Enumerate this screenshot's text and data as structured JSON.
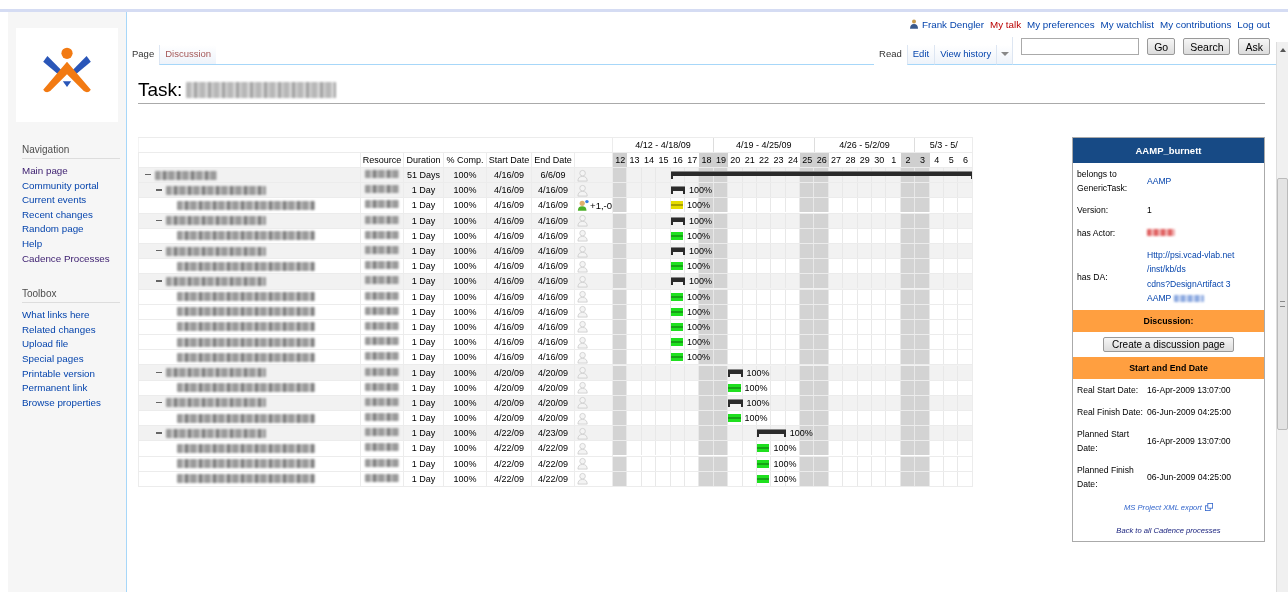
{
  "personal_links": [
    {
      "label": "Frank Dengler",
      "user": true,
      "missing": false
    },
    {
      "label": "My talk",
      "user": false,
      "missing": true
    },
    {
      "label": "My preferences",
      "user": false,
      "missing": false
    },
    {
      "label": "My watchlist",
      "user": false,
      "missing": false
    },
    {
      "label": "My contributions",
      "user": false,
      "missing": false
    },
    {
      "label": "Log out",
      "user": false,
      "missing": false
    }
  ],
  "left_tabs": [
    {
      "label": "Page",
      "selected": true,
      "missing": false
    },
    {
      "label": "Discussion",
      "selected": false,
      "missing": true
    }
  ],
  "right_tabs": [
    {
      "label": "Read",
      "selected": true
    },
    {
      "label": "Edit",
      "selected": false
    },
    {
      "label": "View history",
      "selected": false
    }
  ],
  "search": {
    "buttons": [
      "Go",
      "Search",
      "Ask"
    ]
  },
  "sidebar": {
    "sections": [
      {
        "heading": "Navigation",
        "items": [
          {
            "label": "Main page",
            "visited": true
          },
          {
            "label": "Community portal",
            "visited": false
          },
          {
            "label": "Current events",
            "visited": false
          },
          {
            "label": "Recent changes",
            "visited": false
          },
          {
            "label": "Random page",
            "visited": false
          },
          {
            "label": "Help",
            "visited": false
          },
          {
            "label": "Cadence Processes",
            "visited": true
          }
        ]
      },
      {
        "heading": "Toolbox",
        "items": [
          {
            "label": "What links here",
            "visited": false
          },
          {
            "label": "Related changes",
            "visited": false
          },
          {
            "label": "Upload file",
            "visited": false
          },
          {
            "label": "Special pages",
            "visited": false
          },
          {
            "label": "Printable version",
            "visited": false
          },
          {
            "label": "Permanent link",
            "visited": false
          },
          {
            "label": "Browse properties",
            "visited": false
          }
        ]
      }
    ]
  },
  "title": {
    "prefix": "Task:"
  },
  "gantt": {
    "columns": [
      "Resource",
      "Duration",
      "% Comp.",
      "Start Date",
      "End Date"
    ],
    "weeks": [
      "4/12 - 4/18/09",
      "4/19 - 4/25/09",
      "4/26 - 5/2/09",
      "5/3 - 5/"
    ],
    "days": [
      {
        "label": "12",
        "weekend": true
      },
      {
        "label": "13",
        "weekend": false
      },
      {
        "label": "14",
        "weekend": false
      },
      {
        "label": "15",
        "weekend": false
      },
      {
        "label": "16",
        "weekend": false
      },
      {
        "label": "17",
        "weekend": false
      },
      {
        "label": "18",
        "weekend": true
      },
      {
        "label": "19",
        "weekend": true
      },
      {
        "label": "20",
        "weekend": false
      },
      {
        "label": "21",
        "weekend": false
      },
      {
        "label": "22",
        "weekend": false
      },
      {
        "label": "23",
        "weekend": false
      },
      {
        "label": "24",
        "weekend": false
      },
      {
        "label": "25",
        "weekend": true
      },
      {
        "label": "26",
        "weekend": true
      },
      {
        "label": "27",
        "weekend": false
      },
      {
        "label": "28",
        "weekend": false
      },
      {
        "label": "29",
        "weekend": false
      },
      {
        "label": "30",
        "weekend": false
      },
      {
        "label": "1",
        "weekend": false
      },
      {
        "label": "2",
        "weekend": true
      },
      {
        "label": "3",
        "weekend": true
      },
      {
        "label": "4",
        "weekend": false
      },
      {
        "label": "5",
        "weekend": false
      },
      {
        "label": "6",
        "weekend": false
      }
    ],
    "rows": [
      {
        "kind": "summary",
        "expanded": true,
        "duration": "51 Days",
        "complete": "100%",
        "start": "4/16/09",
        "end": "6/6/09",
        "icon_active": false,
        "children": [
          {
            "kind": "summary",
            "expanded": true,
            "duration": "1 Day",
            "complete": "100%",
            "start": "4/16/09",
            "end": "4/16/09",
            "bar_label": "100%",
            "icon_active": false,
            "children": [
              {
                "kind": "task",
                "duration": "1 Day",
                "complete": "100%",
                "start": "4/16/09",
                "end": "4/16/09",
                "bar_label": "100%",
                "color": "#e6dc00",
                "icon_active": true,
                "votes": "+1,-0"
              }
            ]
          },
          {
            "kind": "summary",
            "expanded": true,
            "duration": "1 Day",
            "complete": "100%",
            "start": "4/16/09",
            "end": "4/16/09",
            "bar_label": "100%",
            "icon_active": false,
            "children": [
              {
                "kind": "task",
                "duration": "1 Day",
                "complete": "100%",
                "start": "4/16/09",
                "end": "4/16/09",
                "bar_label": "100%",
                "color": "#1fe01f",
                "icon_active": false
              }
            ]
          },
          {
            "kind": "summary",
            "expanded": true,
            "duration": "1 Day",
            "complete": "100%",
            "start": "4/16/09",
            "end": "4/16/09",
            "bar_label": "100%",
            "icon_active": false,
            "children": [
              {
                "kind": "task",
                "duration": "1 Day",
                "complete": "100%",
                "start": "4/16/09",
                "end": "4/16/09",
                "bar_label": "100%",
                "color": "#1fe01f",
                "icon_active": false
              }
            ]
          },
          {
            "kind": "summary",
            "expanded": true,
            "duration": "1 Day",
            "complete": "100%",
            "start": "4/16/09",
            "end": "4/16/09",
            "bar_label": "100%",
            "icon_active": false,
            "children": [
              {
                "kind": "task",
                "duration": "1 Day",
                "complete": "100%",
                "start": "4/16/09",
                "end": "4/16/09",
                "bar_label": "100%",
                "color": "#1fe01f",
                "icon_active": false
              },
              {
                "kind": "task",
                "duration": "1 Day",
                "complete": "100%",
                "start": "4/16/09",
                "end": "4/16/09",
                "bar_label": "100%",
                "color": "#1fe01f",
                "icon_active": false
              },
              {
                "kind": "task",
                "duration": "1 Day",
                "complete": "100%",
                "start": "4/16/09",
                "end": "4/16/09",
                "bar_label": "100%",
                "color": "#1fe01f",
                "icon_active": false
              },
              {
                "kind": "task",
                "duration": "1 Day",
                "complete": "100%",
                "start": "4/16/09",
                "end": "4/16/09",
                "bar_label": "100%",
                "color": "#1fe01f",
                "icon_active": false
              },
              {
                "kind": "task",
                "duration": "1 Day",
                "complete": "100%",
                "start": "4/16/09",
                "end": "4/16/09",
                "bar_label": "100%",
                "color": "#1fe01f",
                "icon_active": false
              }
            ]
          },
          {
            "kind": "summary",
            "expanded": true,
            "duration": "1 Day",
            "complete": "100%",
            "start": "4/20/09",
            "end": "4/20/09",
            "bar_label": "100%",
            "icon_active": false,
            "children": [
              {
                "kind": "task",
                "duration": "1 Day",
                "complete": "100%",
                "start": "4/20/09",
                "end": "4/20/09",
                "bar_label": "100%",
                "color": "#1fe01f",
                "icon_active": false
              }
            ]
          },
          {
            "kind": "summary",
            "expanded": true,
            "duration": "1 Day",
            "complete": "100%",
            "start": "4/20/09",
            "end": "4/20/09",
            "bar_label": "100%",
            "icon_active": false,
            "children": [
              {
                "kind": "task",
                "duration": "1 Day",
                "complete": "100%",
                "start": "4/20/09",
                "end": "4/20/09",
                "bar_label": "100%",
                "color": "#1fe01f",
                "icon_active": false
              }
            ]
          },
          {
            "kind": "summary",
            "expanded": true,
            "duration": "1 Day",
            "complete": "100%",
            "start": "4/22/09",
            "end": "4/23/09",
            "bar_label": "100%",
            "icon_active": false,
            "children": [
              {
                "kind": "task",
                "duration": "1 Day",
                "complete": "100%",
                "start": "4/22/09",
                "end": "4/22/09",
                "bar_label": "100%",
                "color": "#1fe01f",
                "icon_active": false
              },
              {
                "kind": "task",
                "duration": "1 Day",
                "complete": "100%",
                "start": "4/22/09",
                "end": "4/22/09",
                "bar_label": "100%",
                "color": "#1fe01f",
                "icon_active": false
              },
              {
                "kind": "task",
                "duration": "1 Day",
                "complete": "100%",
                "start": "4/22/09",
                "end": "4/22/09",
                "bar_label": "100%",
                "color": "#1fe01f",
                "icon_active": false
              }
            ]
          }
        ]
      }
    ]
  },
  "infobox": {
    "title": "AAMP_burnett",
    "properties": [
      {
        "kind": "link",
        "label": "belongs to GenericTask:",
        "lines": [
          "AAMP"
        ]
      },
      {
        "kind": "text",
        "label": "Version:",
        "lines": [
          "1"
        ]
      },
      {
        "kind": "redacted",
        "label": "has Actor:"
      },
      {
        "kind": "link",
        "label": "has DA:",
        "lines": [
          "Http://psi.vcad-vlab.net",
          "/inst/kb/ds",
          "cdns?DesignArtifact 3",
          "AAMP"
        ],
        "redacted_tail": true
      }
    ],
    "discussion_heading": "Discussion:",
    "discussion_button": "Create a discussion page",
    "dates_heading": "Start and End Date",
    "dates": [
      {
        "label": "Real Start Date:",
        "value": "16-Apr-2009 13:07:00"
      },
      {
        "label": "Real Finish Date:",
        "value": "06-Jun-2009 04:25:00"
      },
      {
        "label": "Planned Start Date:",
        "value": "16-Apr-2009 13:07:00"
      },
      {
        "label": "Planned Finish Date:",
        "value": "06-Jun-2009 04:25:00"
      }
    ],
    "export_link": "MS Project XML export",
    "back_link": "Back to all Cadence processes"
  }
}
